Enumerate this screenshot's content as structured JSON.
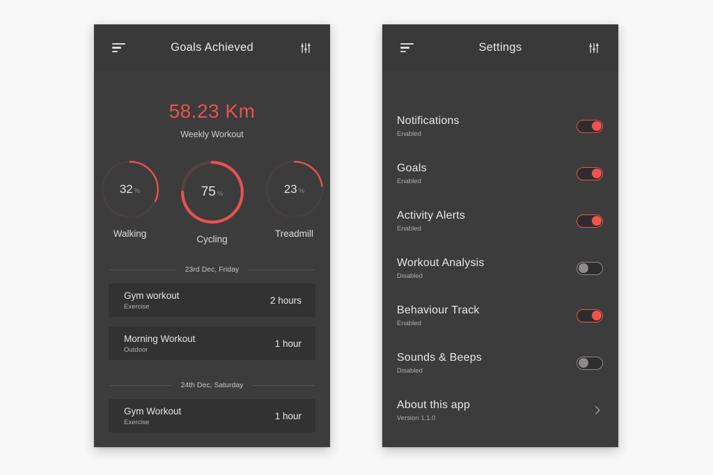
{
  "accent_color": "#e8524f",
  "panel_bg": "#3d3c3c",
  "card_bg": "#333232",
  "goals_screen": {
    "header": {
      "title": "Goals Achieved",
      "menu_icon": "menu-icon",
      "settings_icon": "sliders-icon"
    },
    "summary": {
      "distance": "58.23 Km",
      "label": "Weekly Workout"
    },
    "rings": [
      {
        "percent": "32",
        "sign": "%",
        "caption": "Walking",
        "value": 32,
        "primary": false
      },
      {
        "percent": "75",
        "sign": "%",
        "caption": "Cycling",
        "value": 75,
        "primary": true
      },
      {
        "percent": "23",
        "sign": "%",
        "caption": "Treadmill",
        "value": 23,
        "primary": false
      }
    ],
    "days": [
      {
        "label": "23rd Dec, Friday",
        "entries": [
          {
            "title": "Gym workout",
            "subtitle": "Exercise",
            "duration": "2 hours"
          },
          {
            "title": "Morning Workout",
            "subtitle": "Outdoor",
            "duration": "1 hour"
          }
        ]
      },
      {
        "label": "24th Dec, Saturday",
        "entries": [
          {
            "title": "Gym Workout",
            "subtitle": "Exercise",
            "duration": "1 hour"
          }
        ]
      }
    ]
  },
  "settings_screen": {
    "header": {
      "title": "Settings",
      "menu_icon": "menu-icon",
      "settings_icon": "sliders-icon"
    },
    "rows": [
      {
        "title": "Notifications",
        "subtitle": "Enabled",
        "control": "toggle",
        "on": true
      },
      {
        "title": "Goals",
        "subtitle": "Enabled",
        "control": "toggle",
        "on": true
      },
      {
        "title": "Activity Alerts",
        "subtitle": "Enabled",
        "control": "toggle",
        "on": true
      },
      {
        "title": "Workout Analysis",
        "subtitle": "Disabled",
        "control": "toggle",
        "on": false
      },
      {
        "title": "Behaviour Track",
        "subtitle": "Enabled",
        "control": "toggle",
        "on": true
      },
      {
        "title": "Sounds & Beeps",
        "subtitle": "Disabled",
        "control": "toggle",
        "on": false
      },
      {
        "title": "About this app",
        "subtitle": "Version 1.1.0",
        "control": "chevron",
        "on": null
      }
    ]
  }
}
